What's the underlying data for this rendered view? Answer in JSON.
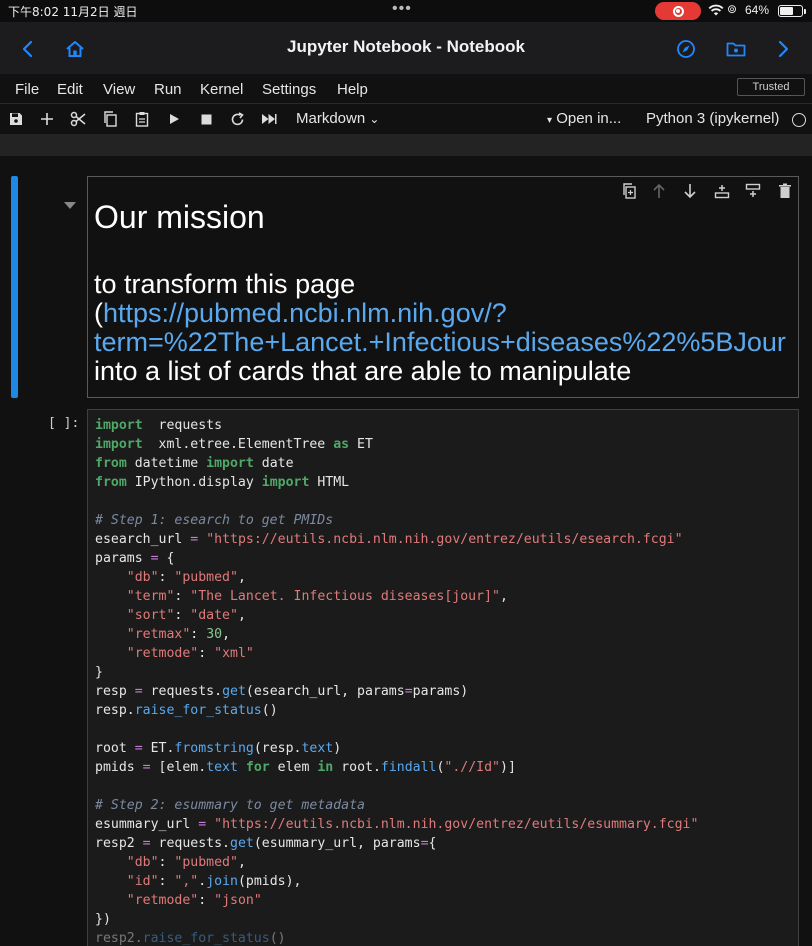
{
  "status_bar": {
    "time": "下午8:02  11月2日 週日",
    "battery": "64%",
    "battery_level": 0.64
  },
  "nav": {
    "title": "Jupyter Notebook - Notebook"
  },
  "menu": {
    "items": [
      "File",
      "Edit",
      "View",
      "Run",
      "Kernel",
      "Settings",
      "Help"
    ],
    "trusted": "Trusted"
  },
  "toolbar": {
    "cell_type": "Markdown",
    "open_in": "Open in...",
    "kernel": "Python 3 (ipykernel)"
  },
  "markdown_cell": {
    "heading": "Our mission",
    "line1": "to transform this page",
    "link_open": "(",
    "link_part1": "https://pubmed.ncbi.nlm.nih.gov/?",
    "link_part2": "term=%22The+Lancet.+Infectious+diseases%22%5BJour",
    "line4": "into a list of cards that are able to manipulate"
  },
  "code_cell": {
    "prompt": "[ ]:",
    "lines": [
      [
        [
          "kw",
          "import"
        ],
        [
          "",
          "  requests"
        ]
      ],
      [
        [
          "kw",
          "import"
        ],
        [
          "",
          "  xml.etree.ElementTree "
        ],
        [
          "kw",
          "as"
        ],
        [
          "",
          " ET"
        ]
      ],
      [
        [
          "kw",
          "from"
        ],
        [
          "",
          " datetime "
        ],
        [
          "kw",
          "import"
        ],
        [
          "",
          " date"
        ]
      ],
      [
        [
          "kw",
          "from"
        ],
        [
          "",
          " IPython.display "
        ],
        [
          "kw",
          "import"
        ],
        [
          "",
          " HTML"
        ]
      ],
      [],
      [
        [
          "cm",
          "# Step 1: esearch to get PMIDs"
        ]
      ],
      [
        [
          "",
          "esearch_url "
        ],
        [
          "op",
          "="
        ],
        [
          "",
          " "
        ],
        [
          "st",
          "\"https://eutils.ncbi.nlm.nih.gov/entrez/eutils/esearch.fcgi\""
        ]
      ],
      [
        [
          "",
          "params "
        ],
        [
          "op",
          "="
        ],
        [
          "",
          " {"
        ]
      ],
      [
        [
          "",
          "    "
        ],
        [
          "st",
          "\"db\""
        ],
        [
          "",
          ": "
        ],
        [
          "st",
          "\"pubmed\""
        ],
        [
          "",
          ","
        ]
      ],
      [
        [
          "",
          "    "
        ],
        [
          "st",
          "\"term\""
        ],
        [
          "",
          ": "
        ],
        [
          "st",
          "\"The Lancet. Infectious diseases[jour]\""
        ],
        [
          "",
          ","
        ]
      ],
      [
        [
          "",
          "    "
        ],
        [
          "st",
          "\"sort\""
        ],
        [
          "",
          ": "
        ],
        [
          "st",
          "\"date\""
        ],
        [
          "",
          ","
        ]
      ],
      [
        [
          "",
          "    "
        ],
        [
          "st",
          "\"retmax\""
        ],
        [
          "",
          ": "
        ],
        [
          "nm",
          "30"
        ],
        [
          "",
          ","
        ]
      ],
      [
        [
          "",
          "    "
        ],
        [
          "st",
          "\"retmode\""
        ],
        [
          "",
          ": "
        ],
        [
          "st",
          "\"xml\""
        ]
      ],
      [
        [
          "",
          "}"
        ]
      ],
      [
        [
          "",
          "resp "
        ],
        [
          "op",
          "="
        ],
        [
          "",
          " requests."
        ],
        [
          "fn",
          "get"
        ],
        [
          "",
          "(esearch_url, params"
        ],
        [
          "op",
          "="
        ],
        [
          "",
          "params)"
        ]
      ],
      [
        [
          "",
          "resp."
        ],
        [
          "fn",
          "raise_for_status"
        ],
        [
          "",
          "()"
        ]
      ],
      [],
      [
        [
          "",
          "root "
        ],
        [
          "op",
          "="
        ],
        [
          "",
          " ET."
        ],
        [
          "fn",
          "fromstring"
        ],
        [
          "",
          "(resp."
        ],
        [
          "fn",
          "text"
        ],
        [
          "",
          ")"
        ]
      ],
      [
        [
          "",
          "pmids "
        ],
        [
          "op",
          "="
        ],
        [
          "",
          " [elem."
        ],
        [
          "fn",
          "text"
        ],
        [
          "",
          " "
        ],
        [
          "kw",
          "for"
        ],
        [
          "",
          " elem "
        ],
        [
          "kw",
          "in"
        ],
        [
          "",
          " root."
        ],
        [
          "fn",
          "findall"
        ],
        [
          "",
          "("
        ],
        [
          "st",
          "\".//Id\""
        ],
        [
          "",
          ")]"
        ]
      ],
      [],
      [
        [
          "cm",
          "# Step 2: esummary to get metadata"
        ]
      ],
      [
        [
          "",
          "esummary_url "
        ],
        [
          "op",
          "="
        ],
        [
          "",
          " "
        ],
        [
          "st",
          "\"https://eutils.ncbi.nlm.nih.gov/entrez/eutils/esummary.fcgi\""
        ]
      ],
      [
        [
          "",
          "resp2 "
        ],
        [
          "op",
          "="
        ],
        [
          "",
          " requests."
        ],
        [
          "fn",
          "get"
        ],
        [
          "",
          "(esummary_url, params"
        ],
        [
          "op",
          "="
        ],
        [
          "",
          "{"
        ]
      ],
      [
        [
          "",
          "    "
        ],
        [
          "st",
          "\"db\""
        ],
        [
          "",
          ": "
        ],
        [
          "st",
          "\"pubmed\""
        ],
        [
          "",
          ","
        ]
      ],
      [
        [
          "",
          "    "
        ],
        [
          "st",
          "\"id\""
        ],
        [
          "",
          ": "
        ],
        [
          "st",
          "\",\""
        ],
        [
          "",
          "."
        ],
        [
          "fn",
          "join"
        ],
        [
          "",
          "(pmids),"
        ]
      ],
      [
        [
          "",
          "    "
        ],
        [
          "st",
          "\"retmode\""
        ],
        [
          "",
          ": "
        ],
        [
          "st",
          "\"json\""
        ]
      ],
      [
        [
          "",
          "})"
        ]
      ],
      [
        [
          "dim",
          "resp2."
        ],
        [
          "dim fn",
          "raise_for_status"
        ],
        [
          "dim",
          "()"
        ]
      ]
    ]
  }
}
